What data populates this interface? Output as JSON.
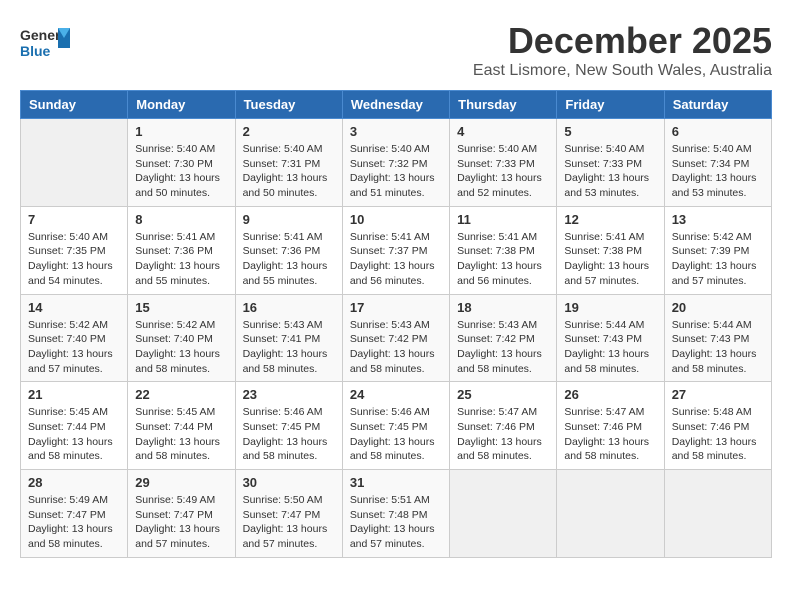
{
  "app": {
    "name": "GeneralBlue",
    "logo_text": "General\nBlue"
  },
  "header": {
    "month": "December 2025",
    "location": "East Lismore, New South Wales, Australia"
  },
  "days_of_week": [
    "Sunday",
    "Monday",
    "Tuesday",
    "Wednesday",
    "Thursday",
    "Friday",
    "Saturday"
  ],
  "weeks": [
    [
      {
        "day": "",
        "info": ""
      },
      {
        "day": "1",
        "info": "Sunrise: 5:40 AM\nSunset: 7:30 PM\nDaylight: 13 hours\nand 50 minutes."
      },
      {
        "day": "2",
        "info": "Sunrise: 5:40 AM\nSunset: 7:31 PM\nDaylight: 13 hours\nand 50 minutes."
      },
      {
        "day": "3",
        "info": "Sunrise: 5:40 AM\nSunset: 7:32 PM\nDaylight: 13 hours\nand 51 minutes."
      },
      {
        "day": "4",
        "info": "Sunrise: 5:40 AM\nSunset: 7:33 PM\nDaylight: 13 hours\nand 52 minutes."
      },
      {
        "day": "5",
        "info": "Sunrise: 5:40 AM\nSunset: 7:33 PM\nDaylight: 13 hours\nand 53 minutes."
      },
      {
        "day": "6",
        "info": "Sunrise: 5:40 AM\nSunset: 7:34 PM\nDaylight: 13 hours\nand 53 minutes."
      }
    ],
    [
      {
        "day": "7",
        "info": "Sunrise: 5:40 AM\nSunset: 7:35 PM\nDaylight: 13 hours\nand 54 minutes."
      },
      {
        "day": "8",
        "info": "Sunrise: 5:41 AM\nSunset: 7:36 PM\nDaylight: 13 hours\nand 55 minutes."
      },
      {
        "day": "9",
        "info": "Sunrise: 5:41 AM\nSunset: 7:36 PM\nDaylight: 13 hours\nand 55 minutes."
      },
      {
        "day": "10",
        "info": "Sunrise: 5:41 AM\nSunset: 7:37 PM\nDaylight: 13 hours\nand 56 minutes."
      },
      {
        "day": "11",
        "info": "Sunrise: 5:41 AM\nSunset: 7:38 PM\nDaylight: 13 hours\nand 56 minutes."
      },
      {
        "day": "12",
        "info": "Sunrise: 5:41 AM\nSunset: 7:38 PM\nDaylight: 13 hours\nand 57 minutes."
      },
      {
        "day": "13",
        "info": "Sunrise: 5:42 AM\nSunset: 7:39 PM\nDaylight: 13 hours\nand 57 minutes."
      }
    ],
    [
      {
        "day": "14",
        "info": "Sunrise: 5:42 AM\nSunset: 7:40 PM\nDaylight: 13 hours\nand 57 minutes."
      },
      {
        "day": "15",
        "info": "Sunrise: 5:42 AM\nSunset: 7:40 PM\nDaylight: 13 hours\nand 58 minutes."
      },
      {
        "day": "16",
        "info": "Sunrise: 5:43 AM\nSunset: 7:41 PM\nDaylight: 13 hours\nand 58 minutes."
      },
      {
        "day": "17",
        "info": "Sunrise: 5:43 AM\nSunset: 7:42 PM\nDaylight: 13 hours\nand 58 minutes."
      },
      {
        "day": "18",
        "info": "Sunrise: 5:43 AM\nSunset: 7:42 PM\nDaylight: 13 hours\nand 58 minutes."
      },
      {
        "day": "19",
        "info": "Sunrise: 5:44 AM\nSunset: 7:43 PM\nDaylight: 13 hours\nand 58 minutes."
      },
      {
        "day": "20",
        "info": "Sunrise: 5:44 AM\nSunset: 7:43 PM\nDaylight: 13 hours\nand 58 minutes."
      }
    ],
    [
      {
        "day": "21",
        "info": "Sunrise: 5:45 AM\nSunset: 7:44 PM\nDaylight: 13 hours\nand 58 minutes."
      },
      {
        "day": "22",
        "info": "Sunrise: 5:45 AM\nSunset: 7:44 PM\nDaylight: 13 hours\nand 58 minutes."
      },
      {
        "day": "23",
        "info": "Sunrise: 5:46 AM\nSunset: 7:45 PM\nDaylight: 13 hours\nand 58 minutes."
      },
      {
        "day": "24",
        "info": "Sunrise: 5:46 AM\nSunset: 7:45 PM\nDaylight: 13 hours\nand 58 minutes."
      },
      {
        "day": "25",
        "info": "Sunrise: 5:47 AM\nSunset: 7:46 PM\nDaylight: 13 hours\nand 58 minutes."
      },
      {
        "day": "26",
        "info": "Sunrise: 5:47 AM\nSunset: 7:46 PM\nDaylight: 13 hours\nand 58 minutes."
      },
      {
        "day": "27",
        "info": "Sunrise: 5:48 AM\nSunset: 7:46 PM\nDaylight: 13 hours\nand 58 minutes."
      }
    ],
    [
      {
        "day": "28",
        "info": "Sunrise: 5:49 AM\nSunset: 7:47 PM\nDaylight: 13 hours\nand 58 minutes."
      },
      {
        "day": "29",
        "info": "Sunrise: 5:49 AM\nSunset: 7:47 PM\nDaylight: 13 hours\nand 57 minutes."
      },
      {
        "day": "30",
        "info": "Sunrise: 5:50 AM\nSunset: 7:47 PM\nDaylight: 13 hours\nand 57 minutes."
      },
      {
        "day": "31",
        "info": "Sunrise: 5:51 AM\nSunset: 7:48 PM\nDaylight: 13 hours\nand 57 minutes."
      },
      {
        "day": "",
        "info": ""
      },
      {
        "day": "",
        "info": ""
      },
      {
        "day": "",
        "info": ""
      }
    ]
  ]
}
